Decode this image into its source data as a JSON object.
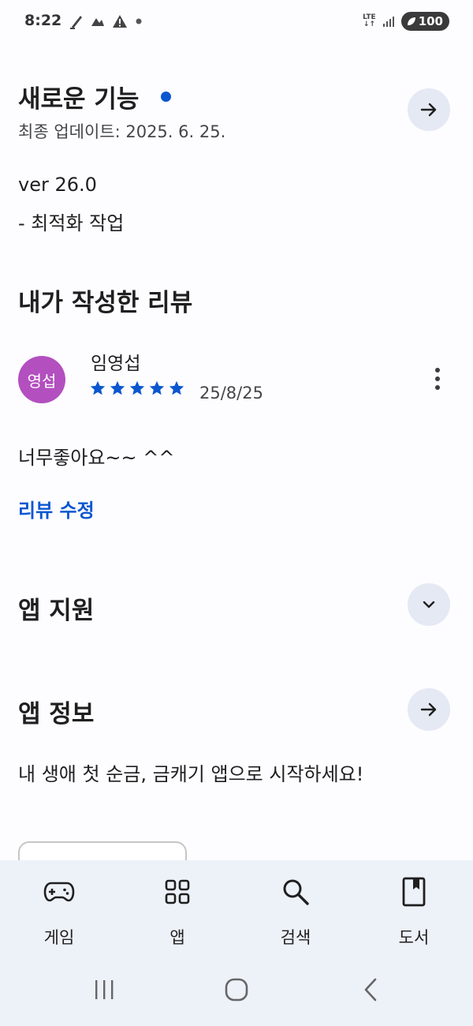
{
  "status_bar": {
    "time": "8:22",
    "battery": "100",
    "icons_left": [
      "edit-note-icon",
      "gesture-icon",
      "warning-icon",
      "dot-icon"
    ],
    "icons_right": [
      "lte-icon",
      "signal-icon",
      "battery-icon"
    ]
  },
  "whats_new": {
    "title": "새로운 기능",
    "updated": "최종 업데이트: 2025. 6. 25.",
    "notes": [
      "ver 26.0",
      "- 최적화 작업"
    ]
  },
  "my_review": {
    "title": "내가 작성한 리뷰",
    "avatar_text": "영섭",
    "avatar_color": "#b34fbf",
    "reviewer": "임영섭",
    "rating": 5,
    "date": "25/8/25",
    "text": "너무좋아요~~ ^^",
    "edit_label": "리뷰 수정"
  },
  "app_support": {
    "title": "앱 지원"
  },
  "app_info": {
    "title": "앱 정보",
    "description": "내 생애 첫 순금, 금캐기 앱으로 시작하세요!"
  },
  "bottom_nav": {
    "items": [
      {
        "label": "게임",
        "icon": "gamepad-icon"
      },
      {
        "label": "앱",
        "icon": "apps-grid-icon"
      },
      {
        "label": "검색",
        "icon": "search-icon"
      },
      {
        "label": "도서",
        "icon": "book-icon"
      }
    ]
  },
  "colors": {
    "accent": "#0b57d0",
    "button_bg": "#e4e9f3",
    "nav_bg": "#edf1f8"
  }
}
